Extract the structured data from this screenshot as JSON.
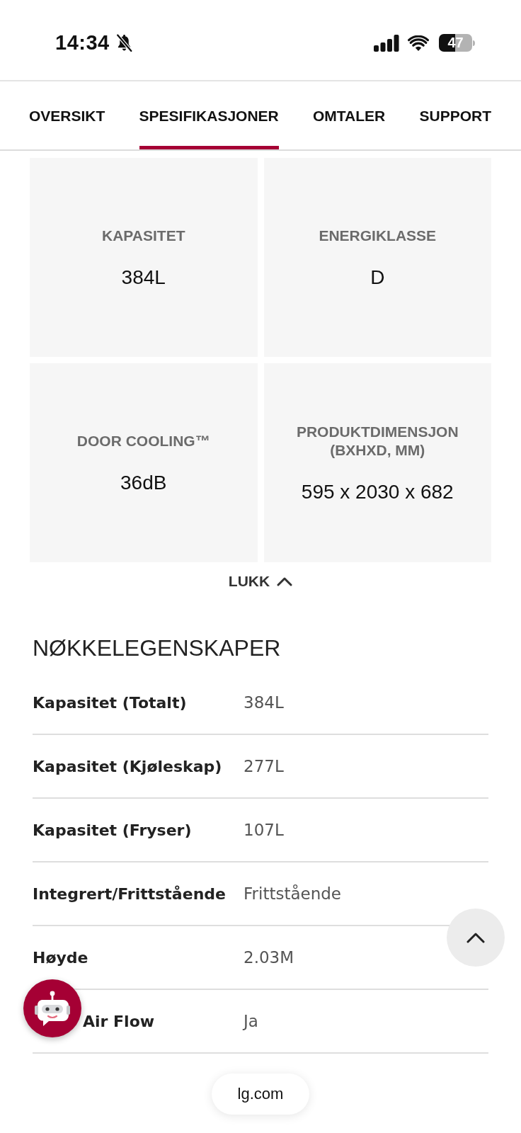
{
  "status_bar": {
    "time": "14:34",
    "battery": "47"
  },
  "tabs": [
    {
      "label": "OVERSIKT",
      "selected": false
    },
    {
      "label": "SPESIFIKASJONER",
      "selected": true
    },
    {
      "label": "OMTALER",
      "selected": false
    },
    {
      "label": "SUPPORT",
      "selected": false
    }
  ],
  "highlights": [
    {
      "label": "KAPASITET",
      "value": "384L"
    },
    {
      "label": "ENERGIKLASSE",
      "value": "D"
    },
    {
      "label": "DOOR COOLING™",
      "value": "36dB"
    },
    {
      "label": "PRODUKTDIMENSJON (BXHXD, MM)",
      "value": "595 x 2030 x 682"
    }
  ],
  "toggle": {
    "label": "LUKK",
    "expanded": true
  },
  "key_features": {
    "title": "NØKKELEGENSKAPER",
    "rows": [
      {
        "label": "Kapasitet (Totalt)",
        "value": "384L",
        "obscured": false
      },
      {
        "label": "Kapasitet (Kjøleskap)",
        "value": "277L",
        "obscured": false
      },
      {
        "label": "Kapasitet (Fryser)",
        "value": "107L",
        "obscured": false
      },
      {
        "label": "Integrert/Frittstående",
        "value": "Frittstående",
        "obscured": false
      },
      {
        "label": "Høyde",
        "value": "2.03M",
        "obscured": false
      },
      {
        "label": "Air Flow",
        "value": "Ja",
        "obscured": true
      }
    ]
  },
  "browser_bar": {
    "url": "lg.com"
  }
}
